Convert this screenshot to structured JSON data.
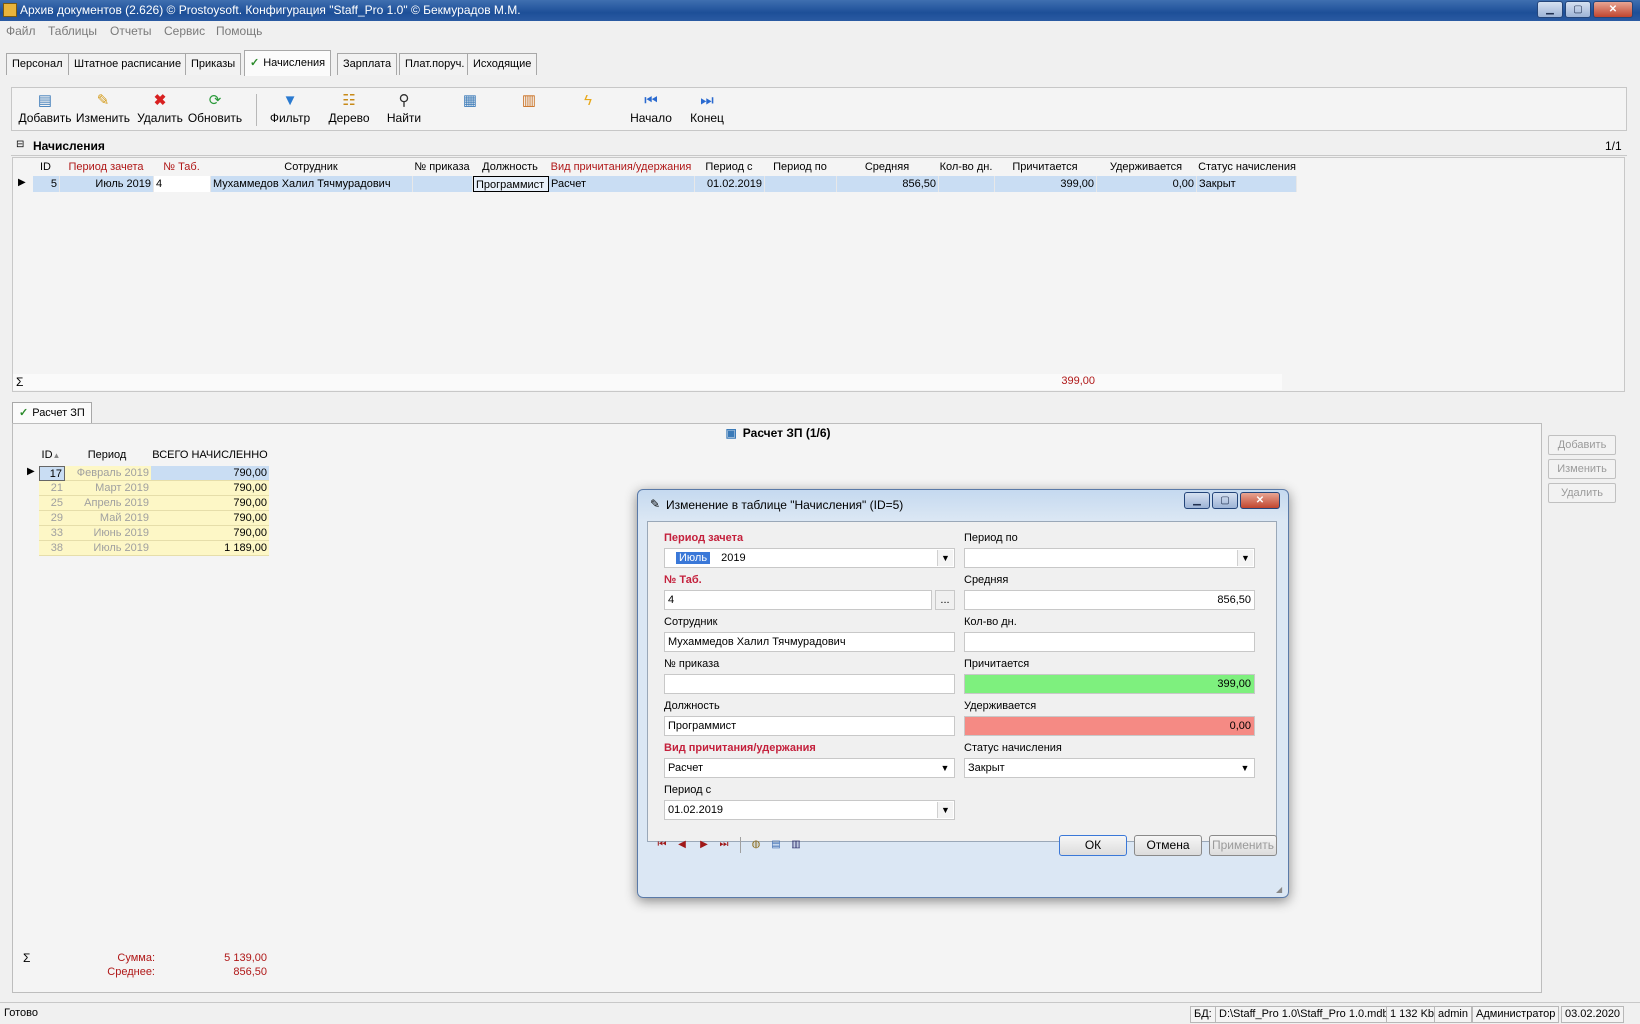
{
  "window": {
    "title": "Архив документов (2.626) © Prostoysoft. Конфигурация \"Staff_Pro 1.0\" © Бекмурадов М.М.",
    "min": "▁",
    "max": "▢",
    "close": "✕"
  },
  "menu": [
    "Файл",
    "Таблицы",
    "Отчеты",
    "Сервис",
    "Помощь"
  ],
  "tabs": [
    "Персонал",
    "Штатное расписание",
    "Приказы",
    "Начисления",
    "Зарплата",
    "Плат.поруч.",
    "Исходящие"
  ],
  "toolbar": {
    "add": "Добавить",
    "edit": "Изменить",
    "delete": "Удалить",
    "refresh": "Обновить",
    "filter": "Фильтр",
    "tree": "Дерево",
    "find": "Найти",
    "start": "Начало",
    "end": "Конец"
  },
  "icons": {
    "add": "document-add-icon",
    "edit": "pencil-icon",
    "delete": "red-x-icon",
    "refresh": "refresh-arrows-icon",
    "filter": "funnel-icon",
    "tree": "tree-icon",
    "find": "binoculars-icon",
    "start": "first-record-icon",
    "end": "last-record-icon"
  },
  "grid": {
    "title": "Начисления",
    "counter": "1/1",
    "columns": [
      "ID",
      "Период зачета",
      "№ Таб.",
      "Сотрудник",
      "№ приказа",
      "Должность",
      "Вид причитания/удержания",
      "Период с",
      "Период по",
      "Средняя",
      "Кол-во дн.",
      "Причитается",
      "Удерживается",
      "Статус начисления"
    ],
    "row": {
      "id": "5",
      "period": "Июль 2019",
      "tab": "4",
      "employee": "Мухаммедов Халил Тячмурадович",
      "order": "",
      "position": "Программист",
      "kind": "Расчет",
      "from": "01.02.2019",
      "to": "",
      "avg": "856,50",
      "days": "",
      "due": "399,00",
      "withheld": "0,00",
      "status": "Закрыт"
    },
    "sum_symbol": "Σ",
    "sum_due": "399,00"
  },
  "lower": {
    "tab": "Расчет ЗП",
    "title": "Расчет ЗП (1/6)",
    "buttons": [
      "Добавить",
      "Изменить",
      "Удалить"
    ],
    "columns": [
      "ID",
      "Период",
      "ВСЕГО НАЧИСЛЕННО"
    ],
    "rows": [
      {
        "id": "17",
        "period": "Февраль 2019",
        "total": "790,00"
      },
      {
        "id": "21",
        "period": "Март 2019",
        "total": "790,00"
      },
      {
        "id": "25",
        "period": "Апрель 2019",
        "total": "790,00"
      },
      {
        "id": "29",
        "period": "Май 2019",
        "total": "790,00"
      },
      {
        "id": "33",
        "period": "Июнь 2019",
        "total": "790,00"
      },
      {
        "id": "38",
        "period": "Июль 2019",
        "total": "1 189,00"
      }
    ],
    "sum_label": "Сумма:",
    "sum_value": "5 139,00",
    "avg_label": "Среднее:",
    "avg_value": "856,50"
  },
  "status": {
    "ready": "Готово",
    "db": "БД:",
    "path": "D:\\Staff_Pro 1.0\\Staff_Pro 1.0.mdb",
    "size": "1 132 Kb",
    "user": "admin",
    "role": "Администратор",
    "date": "03.02.2020"
  },
  "dialog": {
    "title": "Изменение в таблице \"Начисления\" (ID=5)",
    "period_label": "Период зачета",
    "period_month": "Июль",
    "period_year": "2019",
    "to_label": "Период по",
    "to_value": "",
    "tab_label": "№ Таб.",
    "tab_value": "4",
    "browse": "...",
    "avg_label": "Средняя",
    "avg_value": "856,50",
    "emp_label": "Сотрудник",
    "emp_value": "Мухаммедов Халил Тячмурадович",
    "days_label": "Кол-во дн.",
    "days_value": "",
    "order_label": "№ приказа",
    "order_value": "",
    "due_label": "Причитается",
    "due_value": "399,00",
    "pos_label": "Должность",
    "pos_value": "Программист",
    "withheld_label": "Удерживается",
    "withheld_value": "0,00",
    "kind_label": "Вид причитания/удержания",
    "kind_value": "Расчет",
    "status_label": "Статус начисления",
    "status_value": "Закрыт",
    "from_label": "Период с",
    "from_value": "01.02.2019",
    "ok": "ОК",
    "cancel": "Отмена",
    "apply": "Применить",
    "colors": {
      "due_bg": "#7ef07e",
      "withheld_bg": "#f58a84",
      "label_red": "#c4203c"
    }
  }
}
